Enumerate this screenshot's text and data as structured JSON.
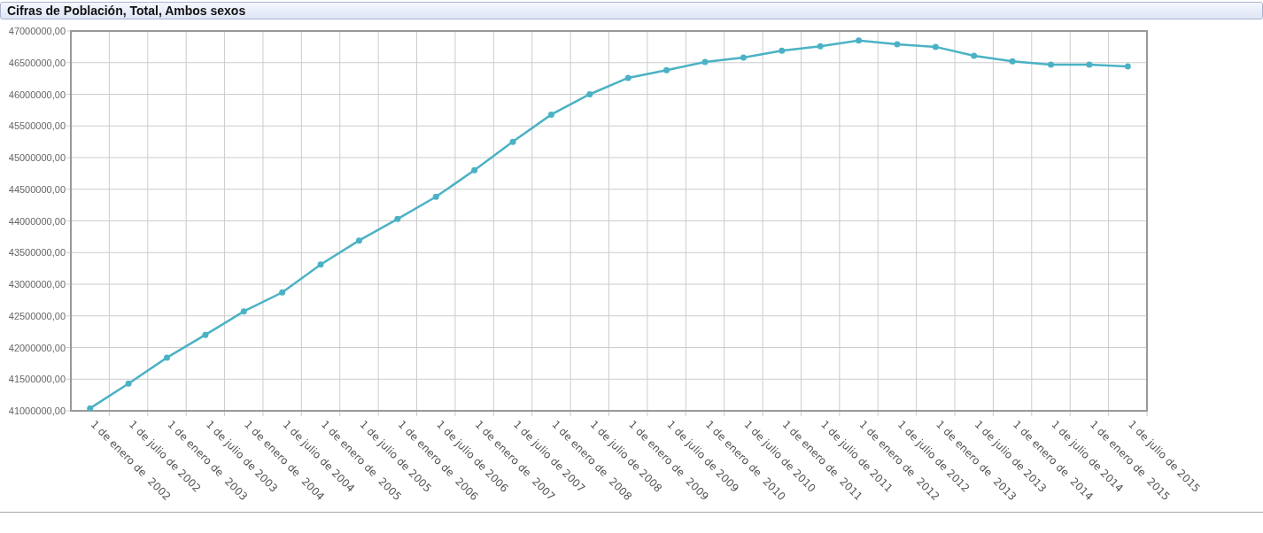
{
  "panel": {
    "title": "Cifras de Población, Total, Ambos sexos"
  },
  "chart_data": {
    "type": "line",
    "categories": [
      "1 de enero de  2002",
      "1 de julio de 2002",
      "1 de enero de  2003",
      "1 de julio de 2003",
      "1 de enero de  2004",
      "1 de julio de 2004",
      "1 de enero de  2005",
      "1 de julio de 2005",
      "1 de enero de  2006",
      "1 de julio de 2006",
      "1 de enero de  2007",
      "1 de julio de 2007",
      "1 de enero de  2008",
      "1 de julio de 2008",
      "1 de enero de  2009",
      "1 de julio de 2009",
      "1 de enero de  2010",
      "1 de julio de 2010",
      "1 de enero de  2011",
      "1 de julio de 2011",
      "1 de enero de  2012",
      "1 de julio de 2012",
      "1 de enero de  2013",
      "1 de julio de 2013",
      "1 de enero de  2014",
      "1 de julio de 2014",
      "1 de enero de  2015",
      "1 de julio de 2015"
    ],
    "grid": true,
    "series": [
      {
        "color": "#4bb2c5",
        "marker": true,
        "values": [
          41040000,
          41430000,
          41840000,
          42200000,
          42570000,
          42870000,
          43310000,
          43690000,
          44030000,
          44380000,
          44800000,
          45250000,
          45680000,
          46000000,
          46260000,
          46380000,
          46510000,
          46580000,
          46690000,
          46760000,
          46850000,
          46790000,
          46750000,
          46610000,
          46520000,
          46470000,
          46470000,
          46440000
        ]
      }
    ],
    "ylim": [
      41000000,
      47000000
    ],
    "yticks": [
      {
        "value": 41000000,
        "label": "41000000,00"
      },
      {
        "value": 41500000,
        "label": "41500000,00"
      },
      {
        "value": 42000000,
        "label": "42000000,00"
      },
      {
        "value": 42500000,
        "label": "42500000,00"
      },
      {
        "value": 43000000,
        "label": "43000000,00"
      },
      {
        "value": 43500000,
        "label": "43500000,00"
      },
      {
        "value": 44000000,
        "label": "44000000,00"
      },
      {
        "value": 44500000,
        "label": "44500000,00"
      },
      {
        "value": 45000000,
        "label": "45000000,00"
      },
      {
        "value": 45500000,
        "label": "45500000,00"
      },
      {
        "value": 46000000,
        "label": "46000000,00"
      },
      {
        "value": 46500000,
        "label": "46500000,00"
      },
      {
        "value": 47000000,
        "label": "47000000,00"
      }
    ]
  }
}
